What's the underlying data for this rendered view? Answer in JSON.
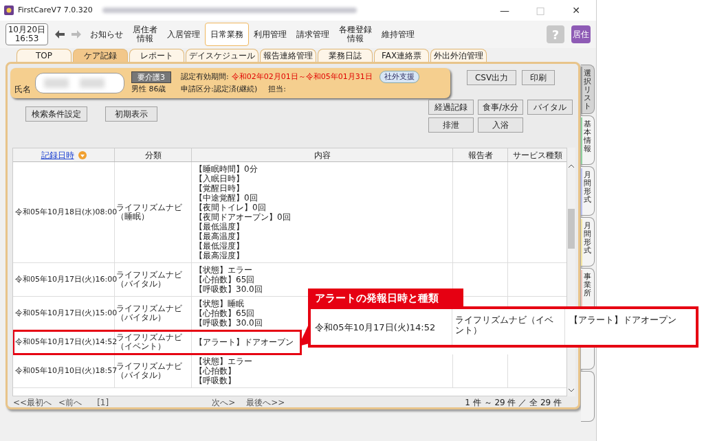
{
  "window": {
    "title": "FirstCareV7 7.0.320",
    "controls": [
      "—",
      "□",
      "✕"
    ]
  },
  "clock": {
    "date": "10月20日",
    "time": "16:53"
  },
  "menu": [
    {
      "lines": [
        "お知らせ"
      ],
      "selected": false
    },
    {
      "lines": [
        "居住者",
        "情報"
      ],
      "selected": false
    },
    {
      "lines": [
        "入居管理"
      ],
      "selected": false
    },
    {
      "lines": [
        "日常業務"
      ],
      "selected": true
    },
    {
      "lines": [
        "利用管理"
      ],
      "selected": false
    },
    {
      "lines": [
        "請求管理"
      ],
      "selected": false
    },
    {
      "lines": [
        "各種登録",
        "情報"
      ],
      "selected": false
    },
    {
      "lines": [
        "維持管理"
      ],
      "selected": false
    }
  ],
  "help_button": "?",
  "user_button": "居住",
  "tabs": [
    {
      "label": "TOP",
      "selected": false
    },
    {
      "label": "ケア記録",
      "selected": true
    },
    {
      "label": "レポート",
      "selected": false
    },
    {
      "label": "デイスケジュール",
      "selected": false
    },
    {
      "label": "報告連絡管理",
      "selected": false
    },
    {
      "label": "業務日誌",
      "selected": false
    },
    {
      "label": "FAX連絡票",
      "selected": false
    },
    {
      "label": "外出外泊管理",
      "selected": false
    }
  ],
  "resident": {
    "label": "氏名",
    "care_level": "要介護3",
    "sex_age": "男性 86歳",
    "period_label": "認定有効期間:",
    "period": "令和02年02月01日～令和05年01月31日",
    "application": "申請区分:認定済(継続)",
    "staff_label": "担当:",
    "badge": "社外支援"
  },
  "top_buttons": [
    "CSV出力",
    "印刷"
  ],
  "left_buttons": [
    "検索条件設定",
    "初期表示"
  ],
  "category_buttons": [
    "経過記録",
    "食事/水分",
    "バイタル",
    "排泄",
    "入浴"
  ],
  "table": {
    "columns": [
      "記録日時",
      "分類",
      "内容",
      "報告者",
      "サービス種類"
    ],
    "rows": [
      {
        "datetime": "令和05年10月18日(水)08:00",
        "category": "ライフリズムナビ（睡眠）",
        "content": [
          "【睡眠時間】0分",
          "【入眠日時】",
          "【覚醒日時】",
          "【中途覚醒】0回",
          "【夜間トイレ】0回",
          "【夜間ドアオープン】0回",
          "【最低温度】",
          "【最高温度】",
          "【最低湿度】",
          "【最高湿度】"
        ],
        "highlighted": false
      },
      {
        "datetime": "令和05年10月17日(火)16:00",
        "category": "ライフリズムナビ（バイタル）",
        "content": [
          "【状態】エラー",
          "【心拍数】65回",
          "【呼吸数】30.0回"
        ],
        "highlighted": false
      },
      {
        "datetime": "令和05年10月17日(火)15:00",
        "category": "ライフリズムナビ（バイタル）",
        "content": [
          "【状態】睡眠",
          "【心拍数】65回",
          "【呼吸数】30.0回"
        ],
        "highlighted": false
      },
      {
        "datetime": "令和05年10月17日(火)14:52",
        "category": "ライフリズムナビ（イベント）",
        "content": [
          "【アラート】ドアオープン"
        ],
        "highlighted": true
      },
      {
        "datetime": "令和05年10月10日(火)18:57",
        "category": "ライフリズムナビ（バイタル）",
        "content": [
          "【状態】エラー",
          "【心拍数】",
          "【呼吸数】"
        ],
        "highlighted": false
      }
    ]
  },
  "pagination": {
    "first": "<<最初へ",
    "prev": "<前へ",
    "page": "[1]",
    "next": "次へ>",
    "last": "最後へ>>",
    "count": "1 件 ～ 29 件 ／ 全 29 件"
  },
  "side_tabs": [
    {
      "label": "選択リスト",
      "color": "#9a9a9a",
      "selected": true
    },
    {
      "label": "基本情報",
      "color": "#8fd19e",
      "selected": false
    },
    {
      "label": "月間形式",
      "color": "#b8bff0",
      "selected": false
    },
    {
      "label": "月間形式",
      "color": "#f5e6a0",
      "selected": false
    },
    {
      "label": "事業所",
      "color": "#f0c4b8",
      "selected": false
    }
  ],
  "callout": {
    "title": "アラートの発報日時と種類",
    "datetime": "令和05年10月17日(火)14:52",
    "category": "ライフリズムナビ（イベント）",
    "content": "【アラート】ドアオープン"
  }
}
